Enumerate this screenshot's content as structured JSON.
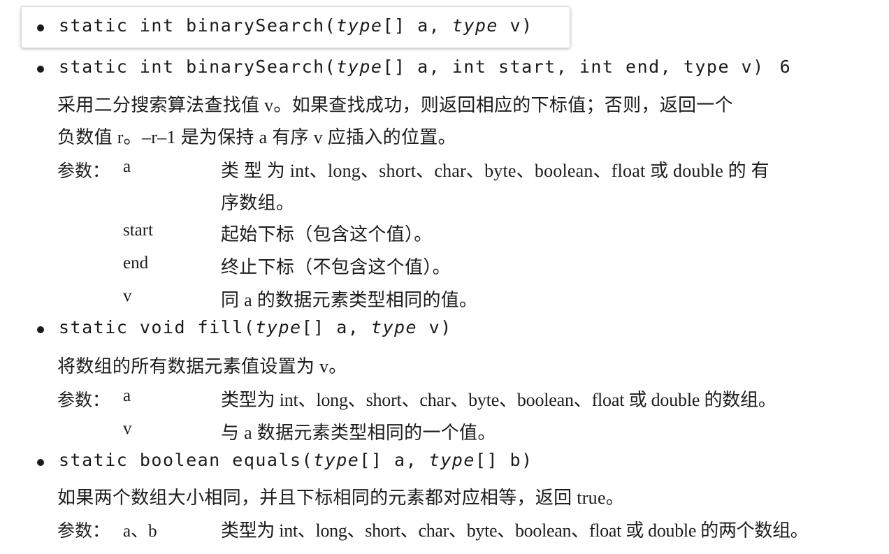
{
  "method1": {
    "name": "binarySearch",
    "line1_prefix": "static int binarySearch(",
    "line1_type1": "type",
    "line1_mid": "[] a, ",
    "line1_type2": "type",
    "line1_suffix": " v)"
  },
  "method2": {
    "prefix": "static int binarySearch(",
    "type1": "type",
    "suffix": "[] a, int start, int end, type v)",
    "version": "6",
    "desc_line1": "采用二分搜索算法查找值 v。如果查找成功，则返回相应的下标值；否则，返回一个",
    "desc_line2": "负数值 r。–r–1 是为保持 a 有序 v 应插入的位置。",
    "params_label": "参数：",
    "params": [
      {
        "name": "a",
        "desc_line1": "类 型 为 int、long、short、char、byte、boolean、float 或 double 的 有",
        "desc_line2": "序数组。"
      },
      {
        "name": "start",
        "desc_line1": "起始下标（包含这个值）。"
      },
      {
        "name": "end",
        "desc_line1": "终止下标（不包含这个值）。"
      },
      {
        "name": "v",
        "desc_line1": "同 a 的数据元素类型相同的值。"
      }
    ]
  },
  "method3": {
    "prefix": "static void fill(",
    "type1": "type",
    "mid": "[] a, ",
    "type2": "type",
    "suffix": " v)",
    "desc": "将数组的所有数据元素值设置为 v。",
    "params_label": "参数：",
    "params": [
      {
        "name": "a",
        "desc": "类型为 int、long、short、char、byte、boolean、float 或 double 的数组。"
      },
      {
        "name": "v",
        "desc": "与 a 数据元素类型相同的一个值。"
      }
    ]
  },
  "method4": {
    "prefix": "static boolean equals(",
    "type1": "type",
    "mid": "[] a, ",
    "type2": "type",
    "suffix": "[] b)",
    "desc": "如果两个数组大小相同，并且下标相同的元素都对应相等，返回 true。",
    "params_label": "参数：",
    "params": [
      {
        "name": "a、b",
        "desc": "类型为 int、long、short、char、byte、boolean、float 或 double 的两个数组。"
      }
    ]
  }
}
